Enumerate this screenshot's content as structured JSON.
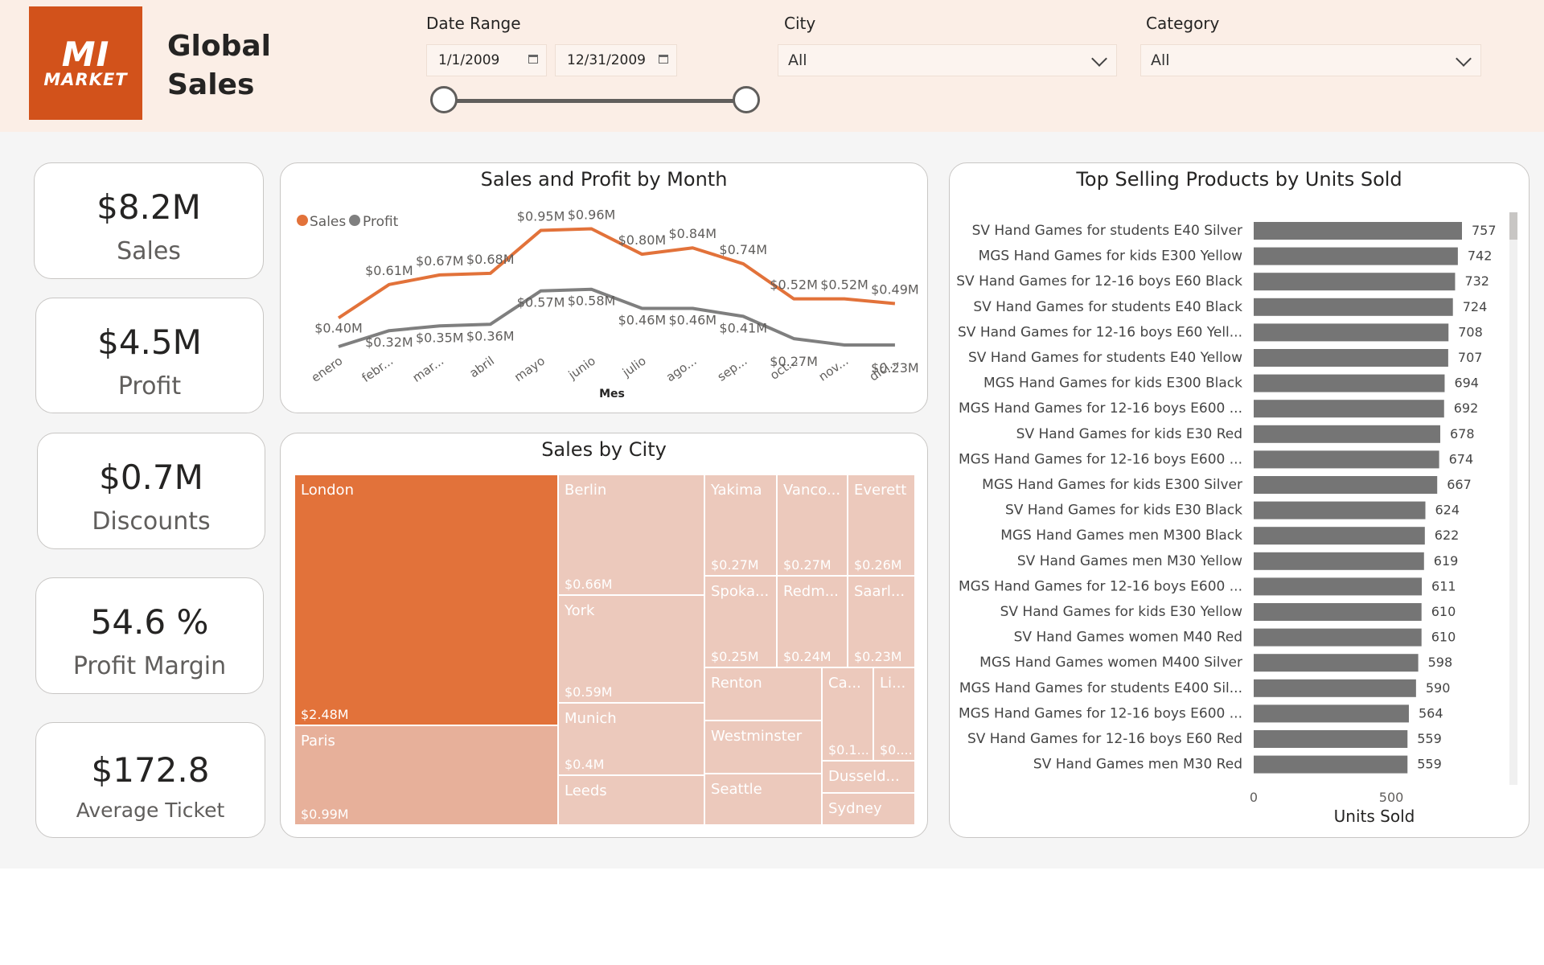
{
  "header": {
    "logo": {
      "line1": "MI",
      "line2": "MARKET"
    },
    "title": "Global Sales"
  },
  "filters": {
    "date_range": {
      "label": "Date Range",
      "start": "1/1/2009",
      "end": "12/31/2009",
      "start_position": 0.0,
      "end_position": 1.0
    },
    "city": {
      "label": "City",
      "selected": "All"
    },
    "category": {
      "label": "Category",
      "selected": "All"
    }
  },
  "kpis": [
    {
      "value": "$8.2M",
      "label": "Sales"
    },
    {
      "value": "$4.5M",
      "label": "Profit"
    },
    {
      "value": "$0.7M",
      "label": "Discounts"
    },
    {
      "value": "54.6 %",
      "label": "Profit Margin"
    },
    {
      "value": "$172.8",
      "label": "Average Ticket"
    }
  ],
  "colors": {
    "accent": "#d2521b",
    "sales": "#e2723a",
    "profit": "#7f7f7f",
    "bar": "#757575",
    "tile_london": "#e2723a",
    "tile_paris": "#e7b09a",
    "tile_other": "#ecc9bc"
  },
  "line_chart": {
    "title": "Sales and Profit by Month",
    "legend": [
      {
        "name": "Sales",
        "color": "#e2723a"
      },
      {
        "name": "Profit",
        "color": "#7f7f7f"
      }
    ],
    "xlabel": "Mes"
  },
  "treemap": {
    "title": "Sales by City",
    "tiles": [
      {
        "name": "London",
        "value": "$2.48M"
      },
      {
        "name": "Paris",
        "value": "$0.99M"
      },
      {
        "name": "Berlin",
        "value": "$0.66M"
      },
      {
        "name": "York",
        "value": "$0.59M"
      },
      {
        "name": "Munich",
        "value": "$0.4M"
      },
      {
        "name": "Leeds",
        "value": ""
      },
      {
        "name": "Yakima",
        "value": "$0.27M"
      },
      {
        "name": "Vanco...",
        "value": "$0.27M"
      },
      {
        "name": "Everett",
        "value": "$0.26M"
      },
      {
        "name": "Spoka...",
        "value": "$0.25M"
      },
      {
        "name": "Redm...",
        "value": "$0.24M"
      },
      {
        "name": "Saarl...",
        "value": "$0.23M"
      },
      {
        "name": "Renton",
        "value": ""
      },
      {
        "name": "Ca...",
        "value": "$0.1..."
      },
      {
        "name": "Li...",
        "value": "$0...."
      },
      {
        "name": "Westminster",
        "value": ""
      },
      {
        "name": "Seattle",
        "value": ""
      },
      {
        "name": "Dusseld...",
        "value": ""
      },
      {
        "name": "Sydney",
        "value": ""
      }
    ]
  },
  "bar_chart": {
    "title": "Top Selling Products by Units Sold",
    "xlabel": "Units Sold"
  },
  "chart_data": [
    {
      "type": "line",
      "title": "Sales and Profit by Month",
      "xlabel": "Mes",
      "ylabel": "",
      "categories": [
        "enero",
        "febr...",
        "mar...",
        "abril",
        "mayo",
        "junio",
        "julio",
        "ago...",
        "sep...",
        "oct...",
        "nov...",
        "dici..."
      ],
      "series": [
        {
          "name": "Sales",
          "values": [
            0.4,
            0.61,
            0.67,
            0.68,
            0.95,
            0.96,
            0.8,
            0.84,
            0.74,
            0.52,
            0.52,
            0.49
          ],
          "labels": [
            "$0.40M",
            "$0.61M",
            "$0.67M",
            "$0.68M",
            "$0.95M",
            "$0.96M",
            "$0.80M",
            "$0.84M",
            "$0.74M",
            "$0.52M",
            "$0.52M",
            "$0.49M"
          ]
        },
        {
          "name": "Profit",
          "values": [
            0.22,
            0.32,
            0.35,
            0.36,
            0.57,
            0.58,
            0.46,
            0.46,
            0.41,
            0.27,
            0.23,
            0.23
          ],
          "labels": [
            "",
            "$0.32M",
            "$0.35M",
            "$0.36M",
            "$0.57M",
            "$0.58M",
            "$0.46M",
            "$0.46M",
            "$0.41M",
            "$0.27M",
            "",
            "$0.23M"
          ]
        }
      ],
      "legend": "top-left",
      "grid": false
    },
    {
      "type": "bar",
      "orientation": "horizontal",
      "title": "Top Selling Products by Units Sold",
      "xlabel": "Units Sold",
      "xlim": [
        0,
        757
      ],
      "xticks": [
        0,
        500
      ],
      "categories": [
        "SV Hand Games for students E40 Silver",
        "MGS Hand Games for kids E300 Yellow",
        "SV Hand Games for 12-16 boys E60 Black",
        "SV Hand Games for students E40 Black",
        "SV Hand Games for 12-16 boys E60 Yell...",
        "SV Hand Games for students E40 Yellow",
        "MGS Hand Games for kids E300 Black",
        "MGS Hand Games for 12-16 boys E600 ...",
        "SV Hand Games for kids E30 Red",
        "MGS Hand Games for 12-16 boys E600 ...",
        "MGS Hand Games for kids E300 Silver",
        "SV Hand Games for kids E30 Black",
        "MGS Hand Games men M300 Black",
        "SV Hand Games men M30 Yellow",
        "MGS Hand Games for 12-16 boys E600 ...",
        "SV Hand Games for kids E30 Yellow",
        "SV Hand Games women M40 Red",
        "MGS Hand Games women M400 Silver",
        "MGS Hand Games for students E400 Sil...",
        "MGS Hand Games for 12-16 boys E600 ...",
        "SV Hand Games for 12-16 boys E60 Red",
        "SV Hand Games men M30 Red"
      ],
      "values": [
        757,
        742,
        732,
        724,
        708,
        707,
        694,
        692,
        678,
        674,
        667,
        624,
        622,
        619,
        611,
        610,
        610,
        598,
        590,
        564,
        559,
        559
      ]
    }
  ]
}
